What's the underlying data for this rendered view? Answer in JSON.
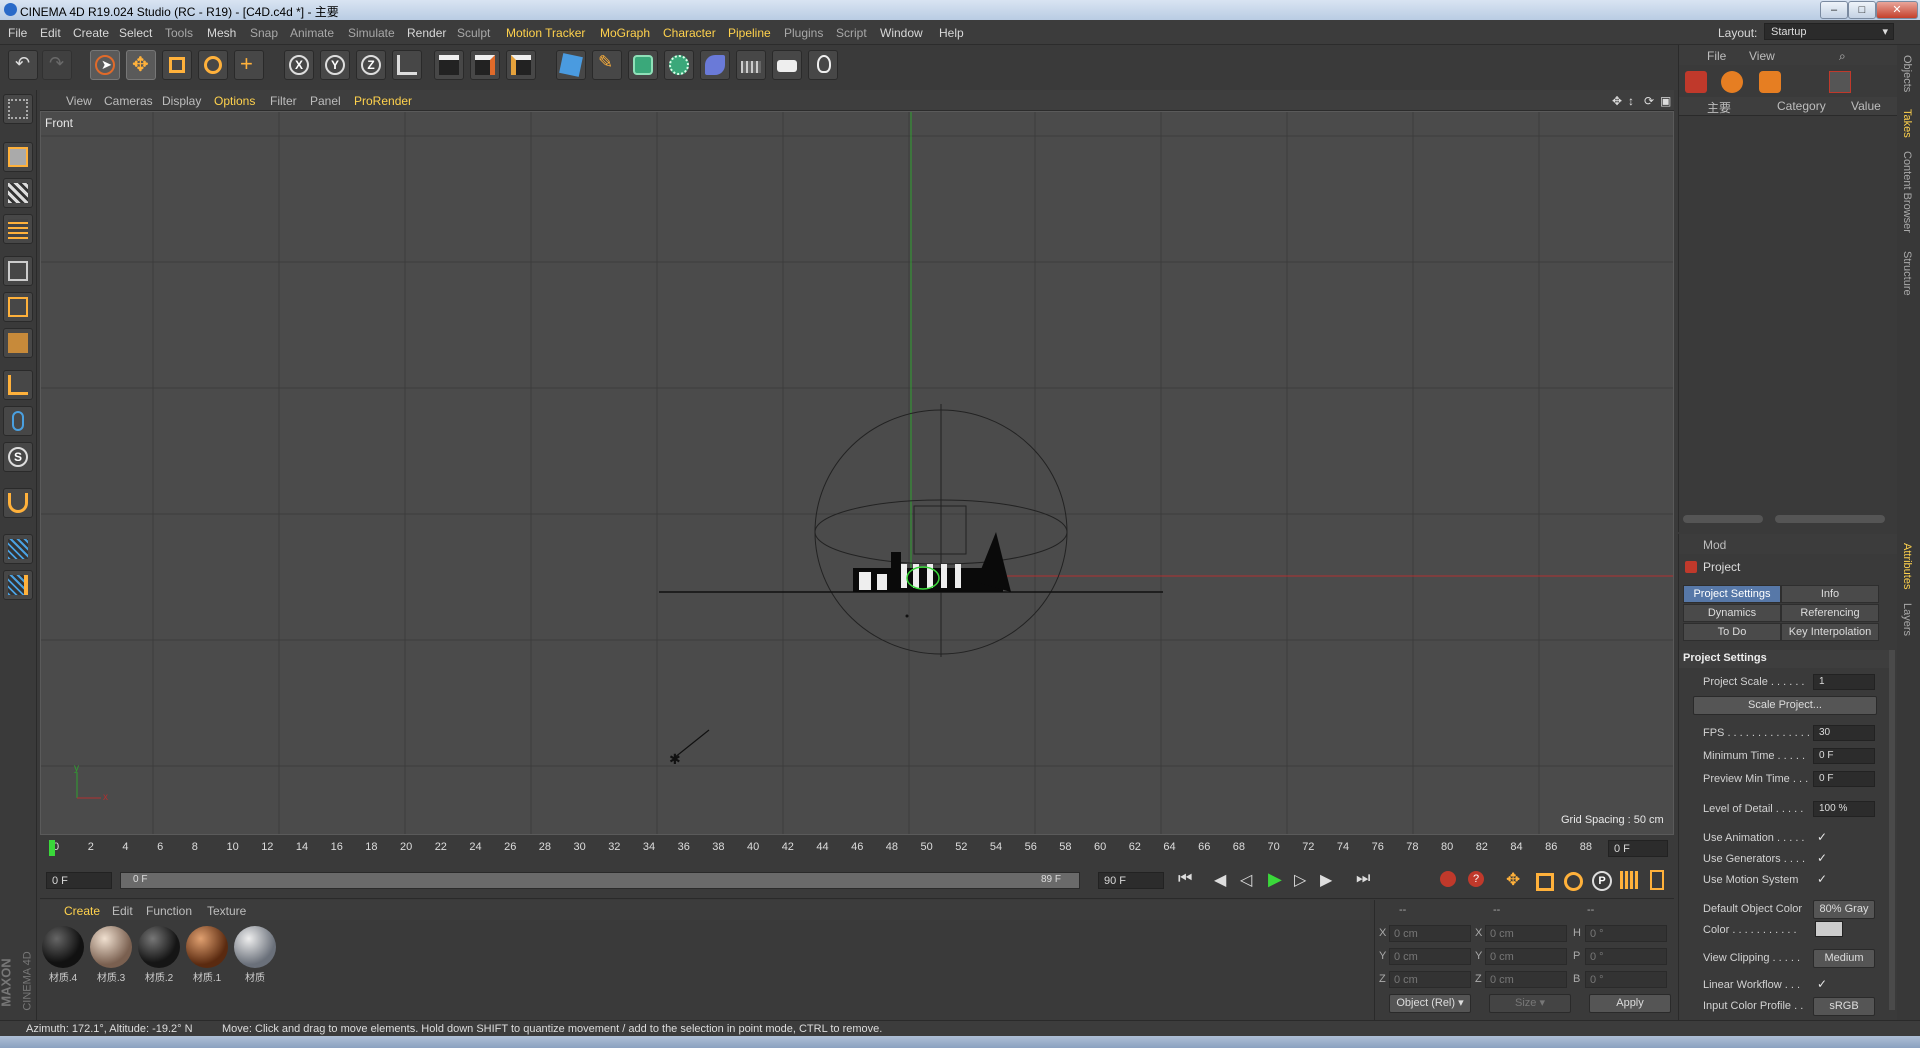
{
  "window": {
    "title": "CINEMA 4D R19.024 Studio (RC - R19) - [C4D.c4d *] - 主要"
  },
  "menubar": {
    "items": [
      "File",
      "Edit",
      "Create",
      "Select",
      "Tools",
      "Mesh",
      "Snap",
      "Animate",
      "Simulate",
      "Render",
      "Sculpt",
      "Motion Tracker",
      "MoGraph",
      "Character",
      "Pipeline",
      "Plugins",
      "Script",
      "Window",
      "Help"
    ],
    "layout_label": "Layout:",
    "layout_value": "Startup"
  },
  "viewport": {
    "menu": [
      "View",
      "Cameras",
      "Display",
      "Options",
      "Filter",
      "Panel",
      "ProRender"
    ],
    "name": "Front",
    "grid_spacing": "Grid Spacing : 50 cm",
    "axis_y": "y",
    "axis_x": "x"
  },
  "timeline": {
    "ticks": [
      "0",
      "2",
      "4",
      "6",
      "8",
      "10",
      "12",
      "14",
      "16",
      "18",
      "20",
      "22",
      "24",
      "26",
      "28",
      "30",
      "32",
      "34",
      "36",
      "38",
      "40",
      "42",
      "44",
      "46",
      "48",
      "50",
      "52",
      "54",
      "56",
      "58",
      "60",
      "62",
      "64",
      "66",
      "68",
      "70",
      "72",
      "74",
      "76",
      "78",
      "80",
      "82",
      "84",
      "86",
      "88"
    ],
    "current_frame": "0 F",
    "start_field": "0 F",
    "range_start": "0 F",
    "range_end": "89 F",
    "end_field": "90 F"
  },
  "material_manager": {
    "menu": [
      "Create",
      "Edit",
      "Function",
      "Texture"
    ],
    "materials": [
      {
        "name": "材质.4",
        "color": "#111"
      },
      {
        "name": "材质.3",
        "color": "#b8a08a"
      },
      {
        "name": "材质.2",
        "color": "#1a1a1a"
      },
      {
        "name": "材质.1",
        "color": "#8a4a2a"
      },
      {
        "name": "材质",
        "color": "#9aa0a8"
      }
    ],
    "brand_top": "MAXON",
    "brand_bottom": "CINEMA 4D"
  },
  "coordinates": {
    "headers": [
      "--",
      "--",
      "--"
    ],
    "rows": [
      {
        "a": "X",
        "av": "0 cm",
        "b": "X",
        "bv": "0 cm",
        "c": "H",
        "cv": "0 °"
      },
      {
        "a": "Y",
        "av": "0 cm",
        "b": "Y",
        "bv": "0 cm",
        "c": "P",
        "cv": "0 °"
      },
      {
        "a": "Z",
        "av": "0 cm",
        "b": "Z",
        "bv": "0 cm",
        "c": "B",
        "cv": "0 °"
      }
    ],
    "mode": "Object (Rel)",
    "size": "Size",
    "apply": "Apply"
  },
  "object_manager": {
    "menu": [
      "File",
      "View"
    ],
    "col_name": "主要",
    "col_category": "Category",
    "col_value": "Value"
  },
  "attributes": {
    "mode": "Mod",
    "object": "Project",
    "tabs": [
      "Project Settings",
      "Info",
      "Dynamics",
      "Referencing",
      "To Do",
      "Key Interpolation"
    ],
    "section": "Project Settings",
    "rows": [
      {
        "label": "Project Scale . . . . . .",
        "value": "1"
      },
      {
        "label": "FPS . . . . . . . . . . . . . . .",
        "value": "30"
      },
      {
        "label": "Minimum Time . . . . .",
        "value": "0 F"
      },
      {
        "label": "Preview Min Time . . .",
        "value": "0 F"
      },
      {
        "label": "Level of Detail . . . . .",
        "value": "100 %"
      },
      {
        "label": "Default Object Color",
        "value": "80% Gray"
      },
      {
        "label": "View Clipping . . . . .",
        "value": "Medium"
      },
      {
        "label": "Input Color Profile . .",
        "value": "sRGB"
      }
    ],
    "scale_button": "Scale Project...",
    "checks": [
      {
        "label": "Use Animation . . . . .",
        "value": "✓"
      },
      {
        "label": "Use Generators . . . .",
        "value": "✓"
      },
      {
        "label": "Use Motion System",
        "value": "✓"
      },
      {
        "label": "Linear Workflow . . .",
        "value": "✓"
      }
    ],
    "color_label": "Color . . . . . . . . . . ."
  },
  "right_tabs": [
    "Objects",
    "Takes",
    "Content Browser",
    "Structure",
    "Attributes",
    "Layers"
  ],
  "status": {
    "left": "Azimuth: 172.1°, Altitude: -19.2°  N",
    "message": "Move: Click and drag to move elements. Hold down SHIFT to quantize movement / add to the selection in point mode, CTRL to remove."
  }
}
